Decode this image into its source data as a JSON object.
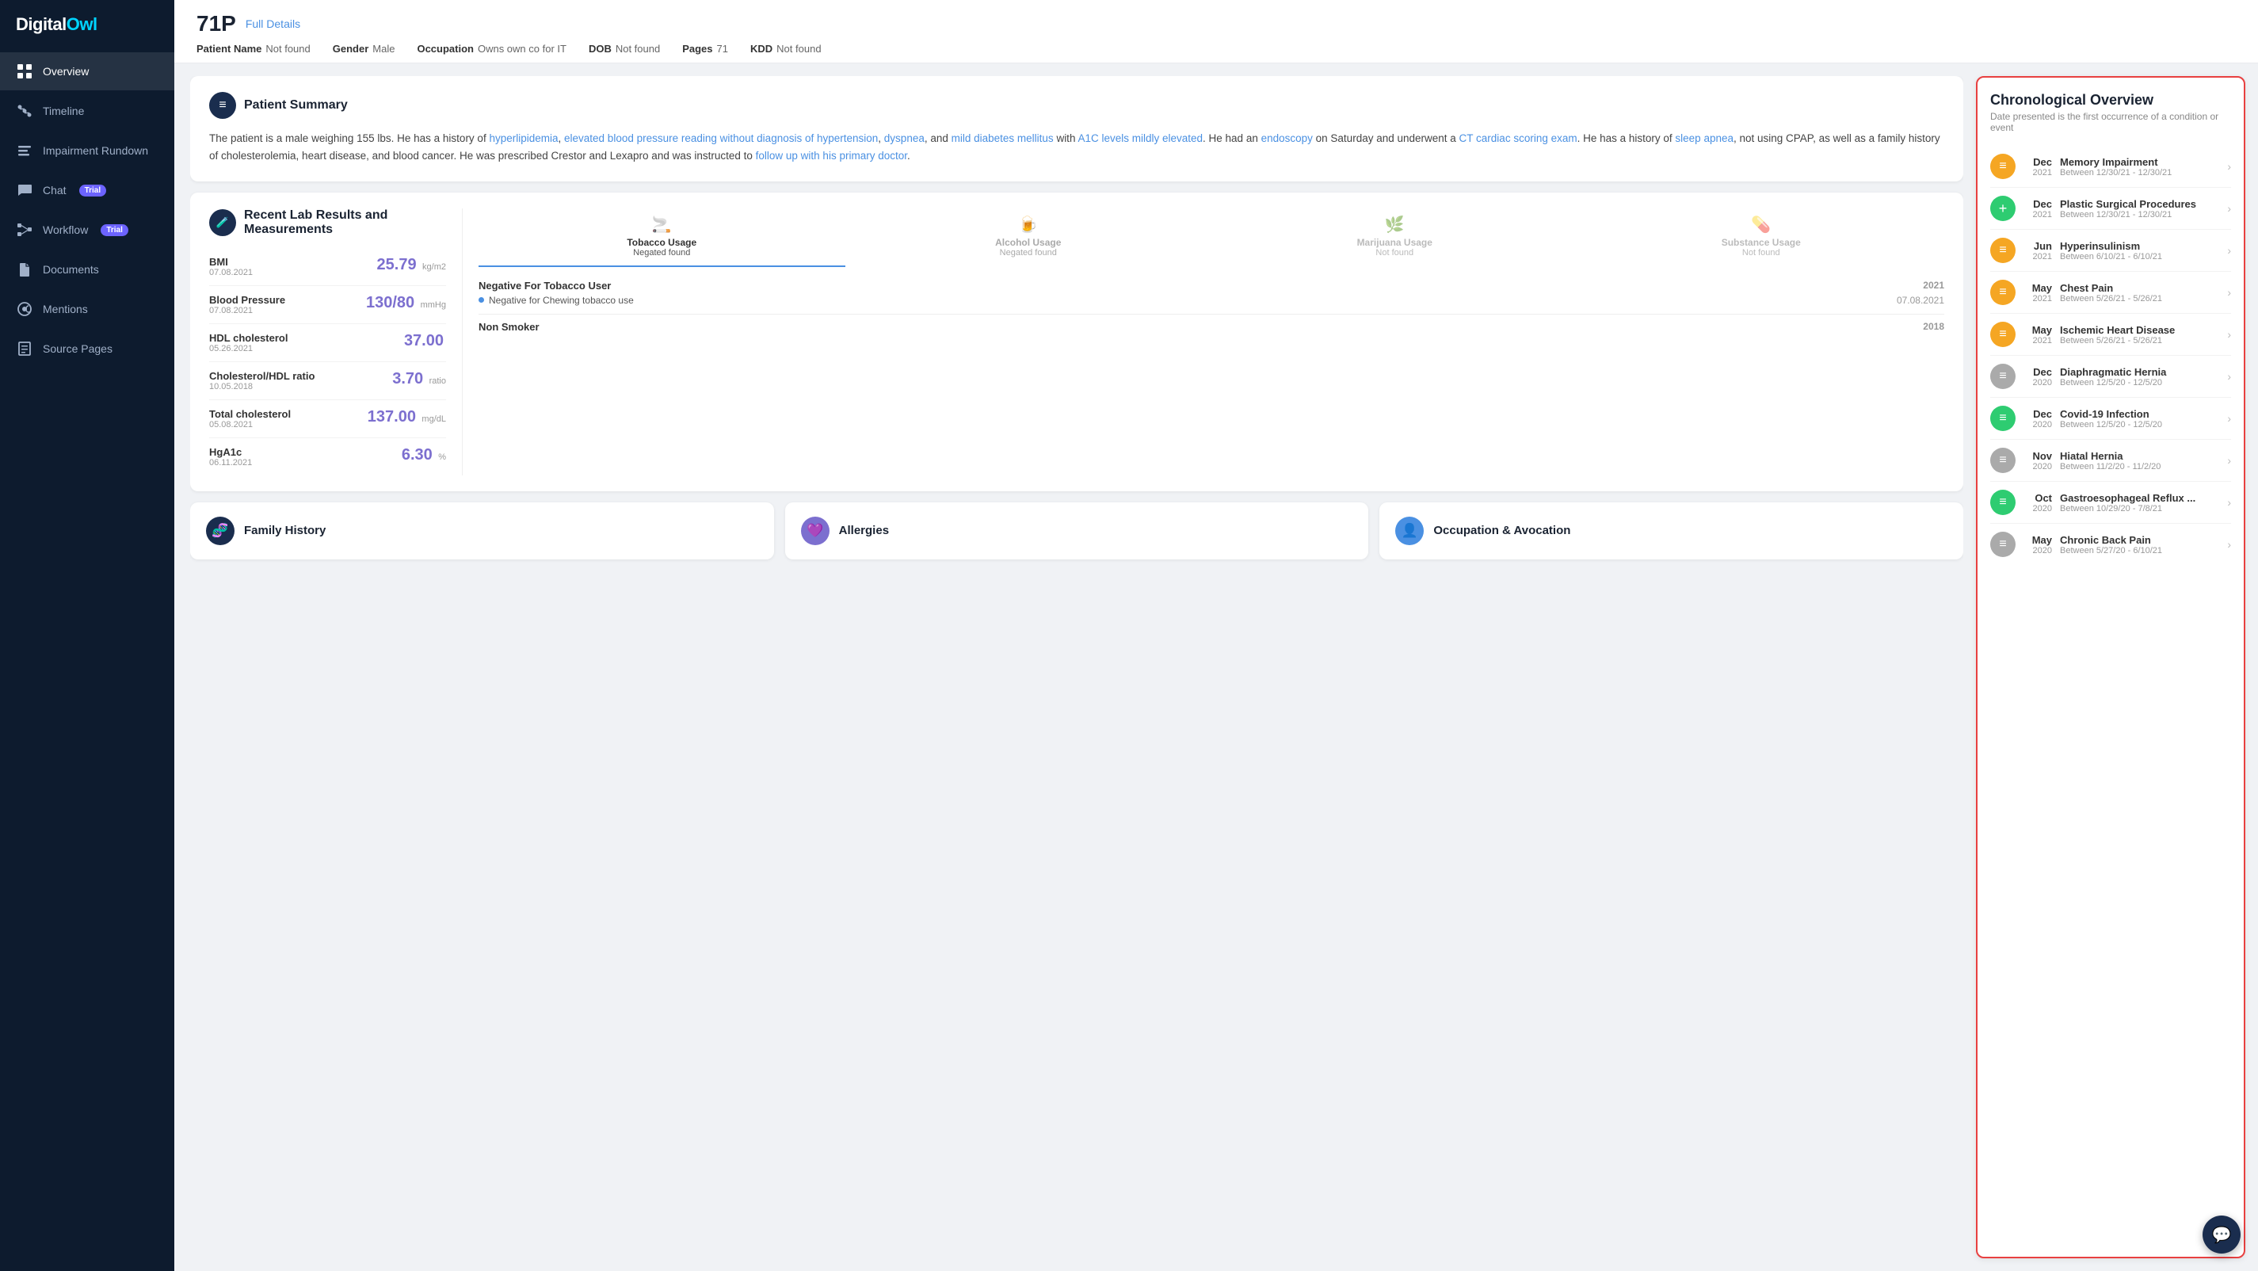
{
  "sidebar": {
    "logo": {
      "text1": "Digital",
      "text2": "Owl"
    },
    "items": [
      {
        "id": "overview",
        "label": "Overview",
        "active": true,
        "icon": "grid"
      },
      {
        "id": "timeline",
        "label": "Timeline",
        "active": false,
        "icon": "timeline"
      },
      {
        "id": "impairment",
        "label": "Impairment Rundown",
        "active": false,
        "icon": "impairment"
      },
      {
        "id": "chat",
        "label": "Chat",
        "active": false,
        "icon": "chat",
        "badge": "Trial"
      },
      {
        "id": "workflow",
        "label": "Workflow",
        "active": false,
        "icon": "workflow",
        "badge": "Trial"
      },
      {
        "id": "documents",
        "label": "Documents",
        "active": false,
        "icon": "documents"
      },
      {
        "id": "mentions",
        "label": "Mentions",
        "active": false,
        "icon": "mentions"
      },
      {
        "id": "source",
        "label": "Source Pages",
        "active": false,
        "icon": "source"
      }
    ]
  },
  "header": {
    "patient_id": "71P",
    "full_details": "Full Details",
    "meta": [
      {
        "label": "Patient Name",
        "value": "Not found"
      },
      {
        "label": "Gender",
        "value": "Male"
      },
      {
        "label": "Occupation",
        "value": "Owns own co for IT"
      },
      {
        "label": "DOB",
        "value": "Not found"
      },
      {
        "label": "Pages",
        "value": "71"
      },
      {
        "label": "KDD",
        "value": "Not found"
      }
    ]
  },
  "patient_summary": {
    "title": "Patient Summary",
    "text_plain": "The patient is a male weighing 155 lbs. He has a history of ",
    "links": [
      "hyperlipidemia",
      "elevated blood pressure reading without diagnosis of hypertension",
      "dyspnea",
      "mild diabetes mellitus",
      "A1C levels mildly elevated",
      "endoscopy",
      "CT cardiac scoring exam",
      "sleep apnea",
      "follow up with his primary doctor"
    ],
    "text_full": "The patient is a male weighing 155 lbs. He has a history of hyperlipidemia, elevated blood pressure reading without diagnosis of hypertension, dyspnea, and mild diabetes mellitus with A1C levels mildly elevated. He had an endoscopy on Saturday and underwent a CT cardiac scoring exam. He has a history of sleep apnea, not using CPAP, as well as a family history of cholesterolemia, heart disease, and blood cancer. He was prescribed Crestor and Lexapro and was instructed to follow up with his primary doctor."
  },
  "lab_results": {
    "title": "Recent Lab Results and Measurements",
    "items": [
      {
        "name": "BMI",
        "date": "07.08.2021",
        "value": "25.79",
        "unit": "kg/m2"
      },
      {
        "name": "Blood Pressure",
        "date": "07.08.2021",
        "value": "130/80",
        "unit": "mmHg"
      },
      {
        "name": "HDL cholesterol",
        "date": "05.26.2021",
        "value": "37.00",
        "unit": ""
      },
      {
        "name": "Cholesterol/HDL ratio",
        "date": "10.05.2018",
        "value": "3.70",
        "unit": "ratio"
      },
      {
        "name": "Total cholesterol",
        "date": "05.08.2021",
        "value": "137.00",
        "unit": "mg/dL"
      },
      {
        "name": "HgA1c",
        "date": "06.11.2021",
        "value": "6.30",
        "unit": "%"
      }
    ]
  },
  "substance": {
    "tabs": [
      {
        "id": "tobacco",
        "label": "Tobacco Usage",
        "status": "Negated found",
        "active": true,
        "icon": "🚬"
      },
      {
        "id": "alcohol",
        "label": "Alcohol Usage",
        "status": "Negated found",
        "active": false,
        "icon": "🍺"
      },
      {
        "id": "marijuana",
        "label": "Marijuana Usage",
        "status": "Not found",
        "active": false,
        "icon": "🌿"
      },
      {
        "id": "substance",
        "label": "Substance Usage",
        "status": "Not found",
        "active": false,
        "icon": "💊"
      }
    ],
    "tobacco_entries": [
      {
        "label": "Negative For Tobacco User",
        "year": "2021",
        "subs": [
          {
            "text": "Negative for Chewing tobacco use",
            "date": "07.08.2021"
          }
        ]
      },
      {
        "label": "Non Smoker",
        "year": "2018",
        "subs": []
      }
    ]
  },
  "bottom_cards": [
    {
      "id": "family",
      "title": "Family History",
      "icon": "🧬",
      "color": "#1a2d4e"
    },
    {
      "id": "allergies",
      "title": "Allergies",
      "icon": "💜",
      "color": "#7c6fcf"
    },
    {
      "id": "occupation",
      "title": "Occupation & Avocation",
      "icon": "👤",
      "color": "#4a90e2"
    }
  ],
  "chronological": {
    "title": "Chronological Overview",
    "subtitle": "Date presented is the first occurrence of a condition or event",
    "items": [
      {
        "month": "Dec",
        "year": "2021",
        "name": "Memory Impairment",
        "range": "Between 12/30/21 - 12/30/21",
        "color": "#f5a623",
        "icon": "≡"
      },
      {
        "month": "Dec",
        "year": "2021",
        "name": "Plastic Surgical Procedures",
        "range": "Between 12/30/21 - 12/30/21",
        "color": "#2ecc71",
        "icon": "+"
      },
      {
        "month": "Jun",
        "year": "2021",
        "name": "Hyperinsulinism",
        "range": "Between 6/10/21 - 6/10/21",
        "color": "#f5a623",
        "icon": "≡"
      },
      {
        "month": "May",
        "year": "2021",
        "name": "Chest Pain",
        "range": "Between 5/26/21 - 5/26/21",
        "color": "#f5a623",
        "icon": "≡"
      },
      {
        "month": "May",
        "year": "2021",
        "name": "Ischemic Heart Disease",
        "range": "Between 5/26/21 - 5/26/21",
        "color": "#f5a623",
        "icon": "≡"
      },
      {
        "month": "Dec",
        "year": "2020",
        "name": "Diaphragmatic Hernia",
        "range": "Between 12/5/20 - 12/5/20",
        "color": "#aaa",
        "icon": "≡"
      },
      {
        "month": "Dec",
        "year": "2020",
        "name": "Covid-19 Infection",
        "range": "Between 12/5/20 - 12/5/20",
        "color": "#2ecc71",
        "icon": "≡"
      },
      {
        "month": "Nov",
        "year": "2020",
        "name": "Hiatal Hernia",
        "range": "Between 11/2/20 - 11/2/20",
        "color": "#aaa",
        "icon": "≡"
      },
      {
        "month": "Oct",
        "year": "2020",
        "name": "Gastroesophageal Reflux ...",
        "range": "Between 10/29/20 - 7/8/21",
        "color": "#2ecc71",
        "icon": "≡"
      },
      {
        "month": "May",
        "year": "2020",
        "name": "Chronic Back Pain",
        "range": "Between 5/27/20 - 6/10/21",
        "color": "#aaa",
        "icon": "≡"
      }
    ]
  },
  "chat_fab": {
    "icon": "💬"
  }
}
